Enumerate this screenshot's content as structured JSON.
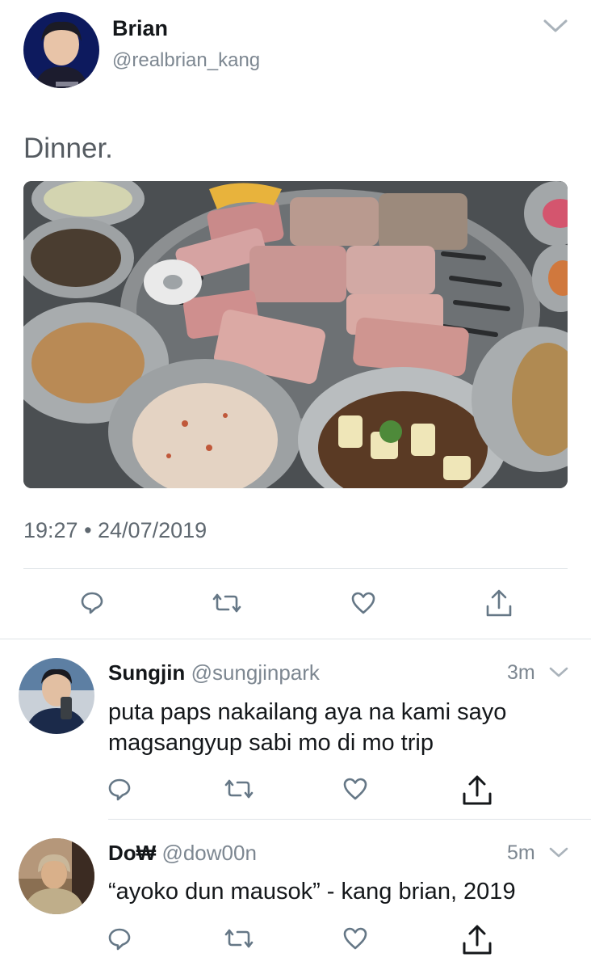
{
  "tweet": {
    "author_name": "Brian",
    "author_handle": "@realbrian_kang",
    "text": "Dinner.",
    "timestamp": "19:27 • 24/07/2019",
    "image_alt": "Korean barbecue dinner with grilled pork belly and side dishes"
  },
  "replies": [
    {
      "name": "Sungjin",
      "handle": "@sungjinpark",
      "time": "3m",
      "text": "puta paps nakailang aya na kami sayo magsangyup sabi mo di mo trip"
    },
    {
      "name": "Do₩",
      "handle": "@dow00n",
      "time": "5m",
      "text": "“ayoko dun mausok” - kang brian, 2019"
    }
  ],
  "icons": {
    "reply": "reply-icon",
    "retweet": "retweet-icon",
    "like": "like-icon",
    "share": "share-icon",
    "menu": "chevron-down-icon"
  }
}
